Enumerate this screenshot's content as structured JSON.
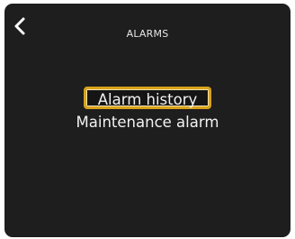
{
  "header": {
    "title": "ALARMS",
    "back_icon": "chevron-left-icon"
  },
  "menu": {
    "items": [
      {
        "label": "Alarm history",
        "selected": true
      },
      {
        "label": "Maintenance alarm",
        "selected": false
      }
    ]
  },
  "colors": {
    "screen_background": "#1e1e1e",
    "text": "#f2f2f2",
    "selection_border": "#d9a21b"
  }
}
